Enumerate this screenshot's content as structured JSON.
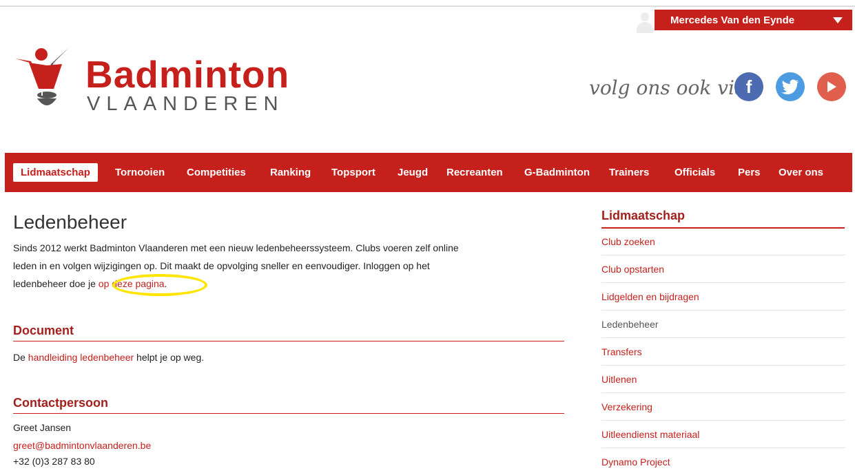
{
  "user_menu": {
    "name": "Mercedes Van den Eynde"
  },
  "logo": {
    "word1": "Badminton",
    "word2": "VLAANDEREN"
  },
  "social": {
    "follow_text": "volg ons ook via",
    "facebook_glyph": "f",
    "icons": [
      "facebook-icon",
      "twitter-icon",
      "youtube-icon"
    ],
    "colors": {
      "facebook": "#4c6bb1",
      "twitter": "#4d9be0",
      "youtube": "#e0604d"
    }
  },
  "nav": {
    "items": [
      {
        "label": "Lidmaatschap",
        "active": true
      },
      {
        "label": "Tornooien"
      },
      {
        "label": "Competities"
      },
      {
        "label": "Ranking"
      },
      {
        "label": "Topsport"
      },
      {
        "label": "Jeugd"
      },
      {
        "label": "Recreanten"
      },
      {
        "label": "G-Badminton"
      },
      {
        "label": "Trainers"
      },
      {
        "label": "Officials"
      },
      {
        "label": "Pers"
      },
      {
        "label": "Over ons"
      }
    ]
  },
  "main": {
    "title": "Ledenbeheer",
    "intro_line1": "Sinds 2012 werkt Badminton Vlaanderen met een nieuw ledenbeheerssysteem. Clubs voeren zelf online",
    "intro_line2": "leden in en volgen wijzigingen op. Dit maakt de opvolging sneller en eenvoudiger. Inloggen op het",
    "intro_line3_prefix": "ledenbeheer doe je ",
    "intro_link": "op deze pagina",
    "intro_line3_suffix": ".",
    "document": {
      "heading": "Document",
      "prefix": "De ",
      "link": "handleiding ledenbeheer",
      "suffix": " helpt je op weg."
    },
    "contact": {
      "heading": "Contactpersoon",
      "name": "Greet Jansen",
      "email": "greet@badmintonvlaanderen.be",
      "phone": "+32 (0)3 287 83 80"
    }
  },
  "sidebar": {
    "title": "Lidmaatschap",
    "items": [
      {
        "label": "Club zoeken"
      },
      {
        "label": "Club opstarten"
      },
      {
        "label": "Lidgelden en bijdragen"
      },
      {
        "label": "Ledenbeheer",
        "current": true
      },
      {
        "label": "Transfers"
      },
      {
        "label": "Uitlenen"
      },
      {
        "label": "Verzekering"
      },
      {
        "label": "Uitleendienst materiaal"
      },
      {
        "label": "Dynamo Project"
      }
    ]
  },
  "colors": {
    "brand_red": "#c6201d",
    "dark_red": "#a3201d",
    "highlight_yellow": "#ffe500"
  }
}
